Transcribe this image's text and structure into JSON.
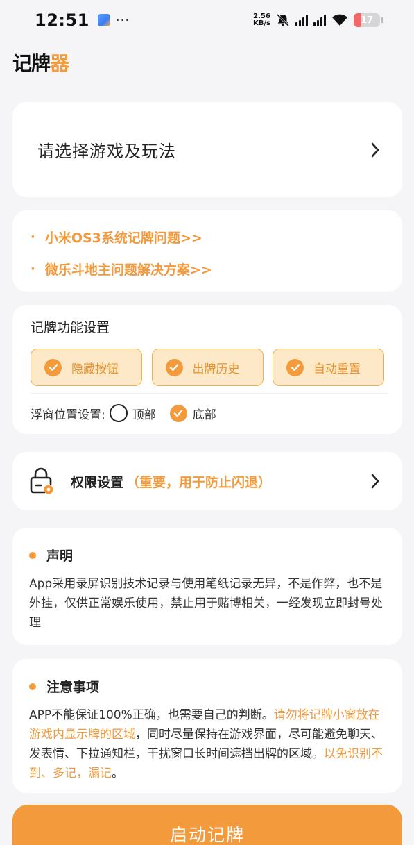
{
  "status_bar": {
    "time": "12:51",
    "more": "···",
    "net_speed_value": "2.56",
    "net_speed_unit": "KB/s",
    "battery_level": "17",
    "battery_fraction": 0.17
  },
  "app": {
    "logo_part1": "记牌",
    "logo_part2": "器"
  },
  "game_select": {
    "label": "请选择游戏及玩法"
  },
  "links": [
    {
      "bullet": "·",
      "text": "小米OS3系统记牌问题>>"
    },
    {
      "bullet": "·",
      "text": "微乐斗地主问题解决方案>>"
    }
  ],
  "settings": {
    "title": "记牌功能设置",
    "options": [
      {
        "label": "隐藏按钮",
        "checked": true
      },
      {
        "label": "出牌历史",
        "checked": true
      },
      {
        "label": "自动重置",
        "checked": true
      }
    ],
    "float_label": "浮窗位置设置:",
    "float_options": [
      {
        "label": "顶部",
        "selected": false
      },
      {
        "label": "底部",
        "selected": true
      }
    ]
  },
  "permission": {
    "title": "权限设置",
    "note": "（重要，用于防止闪退）"
  },
  "declaration": {
    "title": "声明",
    "body": "App采用录屏识别技术记录与使用笔纸记录无异，不是作弊，也不是外挂，仅供正常娱乐使用，禁止用于赌博相关，一经发现立即封号处理"
  },
  "notes": {
    "title": "注意事项",
    "body_1": "APP不能保证100%正确，也需要自己的判断。",
    "body_2": "请勿将记牌小窗放在游戏内显示牌的区域",
    "body_3": "，同时尽量保持在游戏界面，尽可能避免聊天、发表情、下拉通知栏，干扰窗口长时间遮挡出牌的区域。",
    "body_4": "以免识别不到、多记，漏记",
    "body_5": "。"
  },
  "start_button": {
    "label": "启动记牌"
  },
  "colors": {
    "accent": "#f29a3c",
    "option_bg": "#fde9c7",
    "page_bg": "#f5f5f7"
  }
}
